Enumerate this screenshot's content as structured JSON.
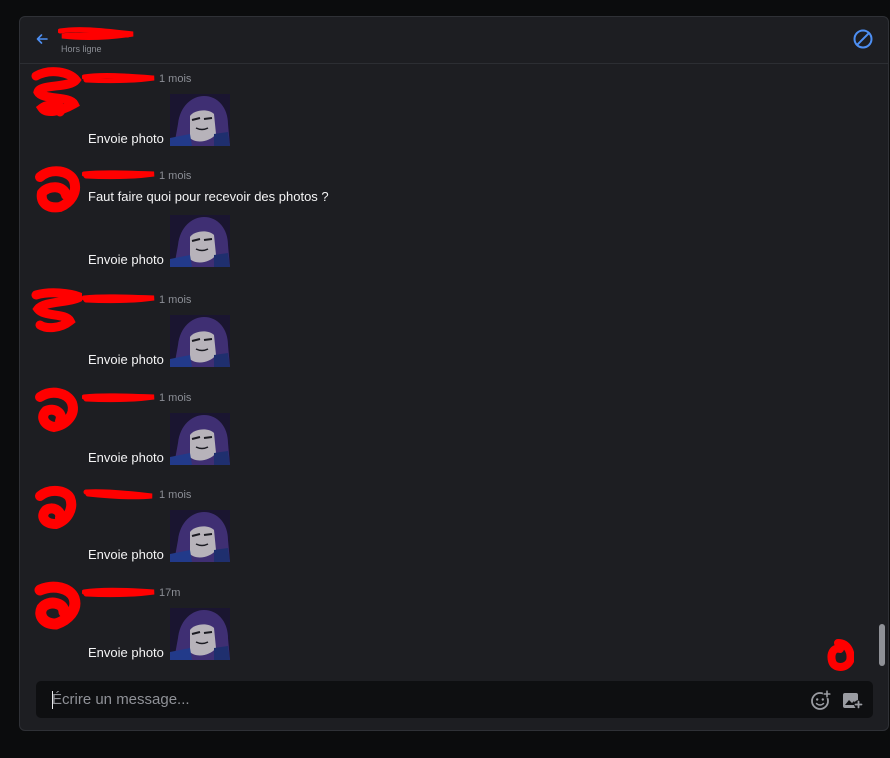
{
  "header": {
    "status": "Hors ligne",
    "back_icon": "arrow-left-icon",
    "block_icon": "block-icon",
    "accent_color": "#4d8ff3"
  },
  "messages": [
    {
      "time": "1 mois",
      "text": null,
      "photo_label": "Envoie photo"
    },
    {
      "time": "1 mois",
      "text": "Faut faire quoi pour recevoir des photos ?",
      "photo_label": "Envoie photo"
    },
    {
      "time": "1 mois",
      "text": null,
      "photo_label": "Envoie photo"
    },
    {
      "time": "1 mois",
      "text": null,
      "photo_label": "Envoie photo"
    },
    {
      "time": "1 mois",
      "text": null,
      "photo_label": "Envoie photo"
    },
    {
      "time": "17m",
      "text": null,
      "photo_label": "Envoie photo"
    }
  ],
  "composer": {
    "placeholder": "Écrire un message...",
    "emoji_icon": "emoji-add-icon",
    "image_icon": "image-add-icon"
  },
  "redaction_color": "#ff0000"
}
